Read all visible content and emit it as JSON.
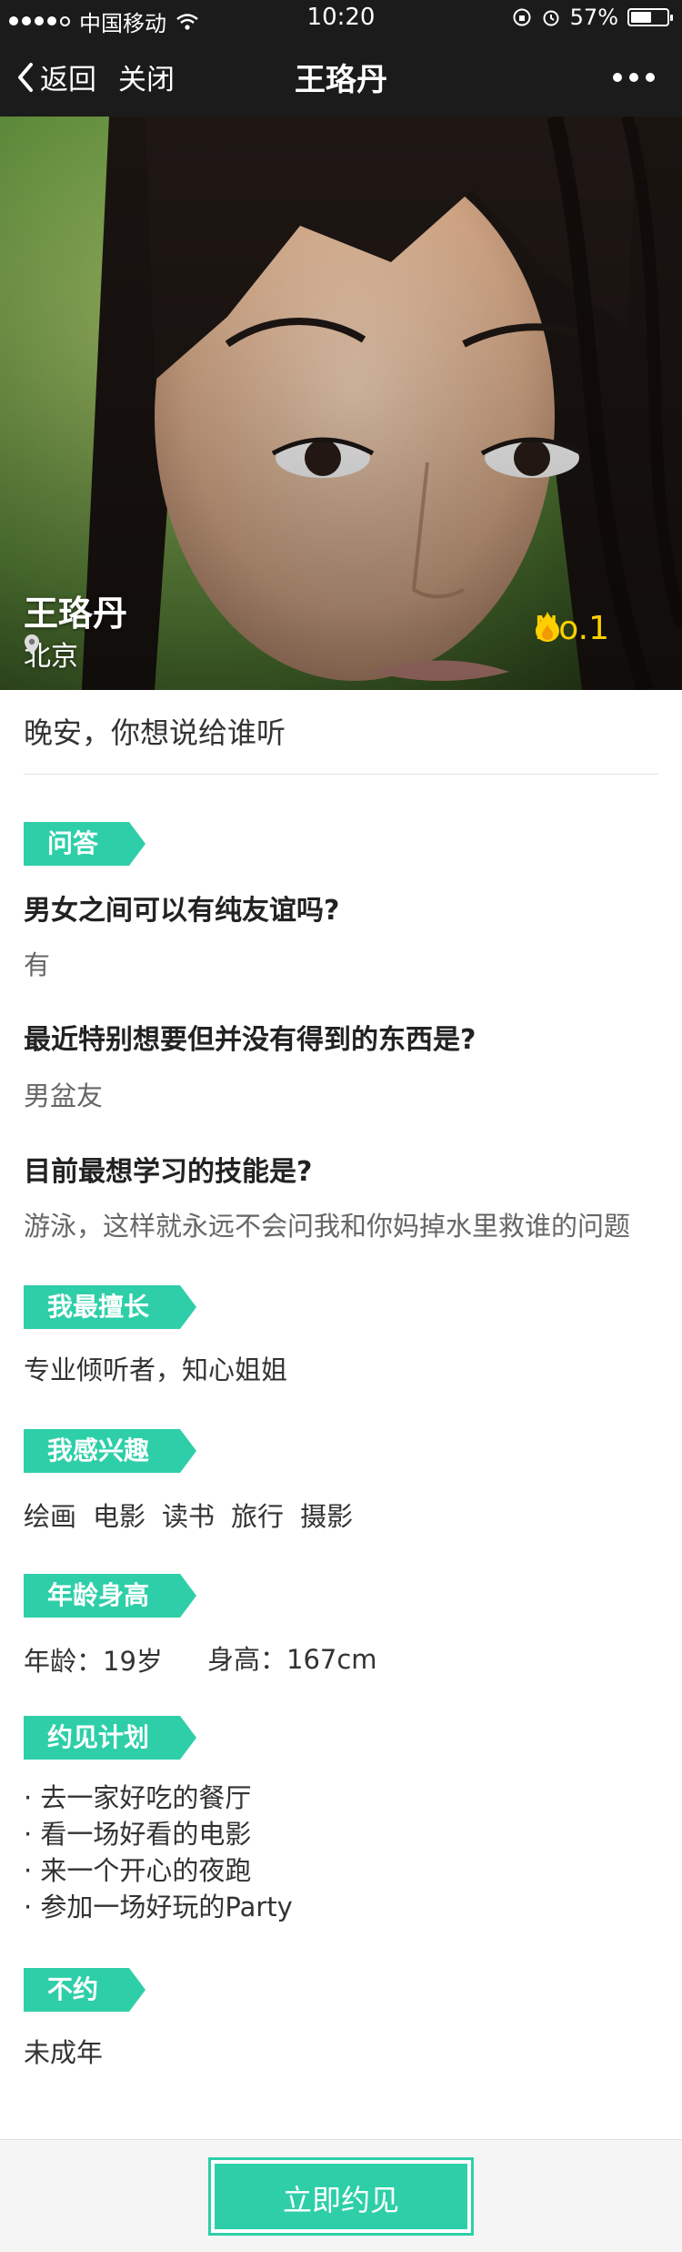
{
  "status_bar": {
    "carrier": "中国移动",
    "time": "10:20",
    "battery": "57%",
    "battery_fraction": 0.57
  },
  "nav": {
    "back_label": "返回",
    "close_label": "关闭",
    "title": "王珞丹"
  },
  "profile": {
    "name": "王珞丹",
    "location": "北京",
    "rank": "No.1",
    "tagline": "晚安，你想说给谁听"
  },
  "sections": {
    "qa": {
      "title": "问答",
      "items": [
        {
          "question": "男女之间可以有纯友谊吗?",
          "answer": "有"
        },
        {
          "question": "最近特别想要但并没有得到的东西是?",
          "answer": "男盆友"
        },
        {
          "question": "目前最想学习的技能是?",
          "answer": "游泳，这样就永远不会问我和你妈掉水里救谁的问题"
        }
      ]
    },
    "skills": {
      "title": "我最擅长",
      "text": "专业倾听者，知心姐姐"
    },
    "interests": {
      "title": "我感兴趣",
      "items": [
        "绘画",
        "电影",
        "读书",
        "旅行",
        "摄影"
      ]
    },
    "age_height": {
      "title": "年龄身高",
      "age": "年龄：19岁",
      "height": "身高：167cm"
    },
    "plans": {
      "title": "约见计划",
      "items": [
        "· 去一家好吃的餐厅",
        "· 看一场好看的电影",
        "· 来一个开心的夜跑",
        "· 参加一场好玩的Party"
      ]
    },
    "no_date": {
      "title": "不约",
      "text": "未成年"
    }
  },
  "cta": {
    "label": "立即约见"
  }
}
